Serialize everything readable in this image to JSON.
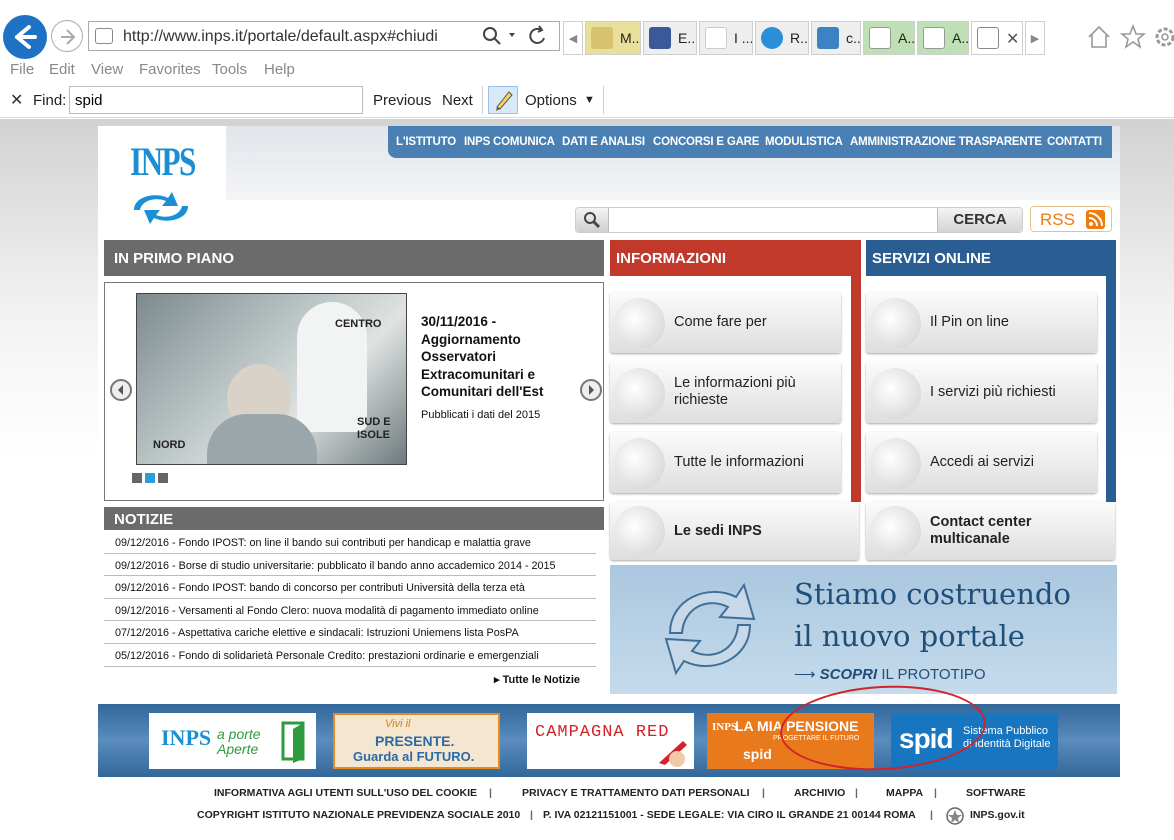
{
  "browser": {
    "url": "http://www.inps.it/portale/default.aspx#chiudi",
    "tabs": [
      "M...",
      "E...",
      "I ...",
      "R...",
      "c...",
      "A...",
      "A...",
      ""
    ],
    "menu": [
      "File",
      "Edit",
      "View",
      "Favorites",
      "Tools",
      "Help"
    ],
    "find": {
      "label": "Find:",
      "value": "spid",
      "previous": "Previous",
      "next": "Next",
      "options": "Options"
    }
  },
  "site": {
    "logo": "INPS",
    "nav": [
      "L'ISTITUTO",
      "INPS COMUNICA",
      "DATI E ANALISI",
      "CONCORSI E GARE",
      "MODULISTICA",
      "AMMINISTRAZIONE TRASPARENTE",
      "CONTATTI"
    ],
    "search_button": "CERCA",
    "rss": "RSS"
  },
  "primo_piano": {
    "title": "IN PRIMO PIANO",
    "headline": "30/11/2016 - Aggiornamento Osservatori Extracomunitari e Comunitari dell'Est",
    "subtitle": "Pubblicati i dati del 2015",
    "photo_labels": {
      "centro": "CENTRO",
      "nord": "NORD",
      "sud": "SUD E ISOLE"
    }
  },
  "notizie": {
    "title": "NOTIZIE",
    "items": [
      "09/12/2016 - Fondo IPOST: on line il bando sui contributi per handicap e malattia grave",
      "09/12/2016 - Borse di studio universitarie: pubblicato il bando anno accademico 2014 - 2015",
      "09/12/2016 - Fondo IPOST: bando di concorso per contributi Università della terza età",
      "09/12/2016 - Versamenti al Fondo Clero: nuova modalità di pagamento immediato online",
      "07/12/2016 - Aspettativa cariche elettive e sindacali: Istruzioni Uniemens lista PosPA",
      "05/12/2016 - Fondo di solidarietà Personale Credito: prestazioni ordinarie e emergenziali"
    ],
    "all": "Tutte le Notizie"
  },
  "informazioni": {
    "title": "INFORMAZIONI",
    "items": [
      "Come fare per",
      "Le informazioni più richieste",
      "Tutte le informazioni"
    ],
    "bottom": "Le sedi INPS"
  },
  "servizi": {
    "title": "SERVIZI ONLINE",
    "items": [
      "Il Pin on line",
      "I servizi più richiesti",
      "Accedi ai servizi"
    ],
    "bottom": "Contact center multicanale"
  },
  "banner": {
    "line1": "Stiamo costruendo",
    "line2": "il nuovo portale",
    "cta_bold": "SCOPRI",
    "cta_rest": "IL PROTOTIPO"
  },
  "footer_banners": {
    "porte": "a porte Aperte",
    "presente1": "Vivi il",
    "presente2": "PRESENTE.",
    "presente3": "Guarda al FUTURO.",
    "red": "CAMPAGNA RED",
    "pensione": "LA MIA PENSIONE",
    "pensione_sub": "PROGETTARE IL FUTURO",
    "spid": "spid",
    "spid_text": "Sistema Pubblico di Identità Digitale"
  },
  "footer": {
    "links": [
      "INFORMATIVA AGLI UTENTI SULL'USO DEL COOKIE",
      "PRIVACY E TRATTAMENTO DATI PERSONALI",
      "ARCHIVIO",
      "MAPPA",
      "SOFTWARE"
    ],
    "copyright": "COPYRIGHT ISTITUTO NAZIONALE PREVIDENZA SOCIALE 2010",
    "piva": "P. IVA 02121151001 - SEDE LEGALE: VIA CIRO IL GRANDE 21 00144 ROMA",
    "govit": "INPS.gov.it"
  },
  "colors": {
    "nav_blue": "#4a7fb3",
    "info_red": "#c0392b",
    "servizi_blue": "#2a5d91",
    "grey_header": "#6b6b6b"
  }
}
